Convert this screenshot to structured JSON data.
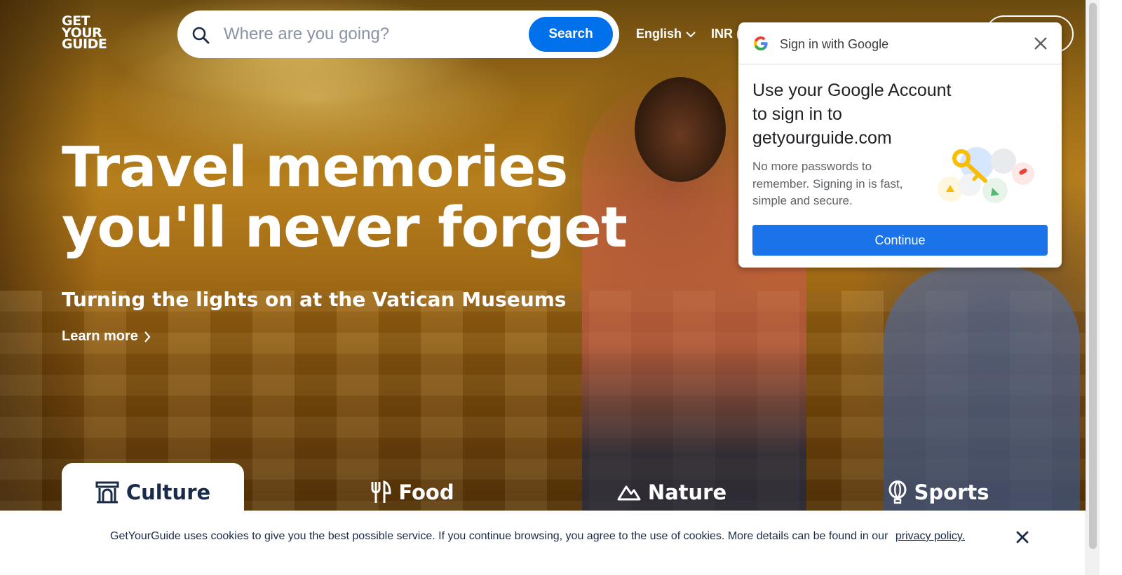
{
  "header": {
    "logo_lines": [
      "GET",
      "YOUR",
      "GUIDE"
    ],
    "search": {
      "placeholder": "Where are you going?",
      "value": "",
      "button_label": "Search"
    },
    "language": "English",
    "currency": "INR (₹)"
  },
  "hero": {
    "headline_lines": [
      "Travel memories",
      "you'll never forget"
    ],
    "subheadline": "Turning the lights on at the Vatican Museums",
    "learn_more": "Learn more"
  },
  "categories": [
    {
      "label": "Culture",
      "icon": "museum-icon",
      "active": true
    },
    {
      "label": "Food",
      "icon": "fork-knife-icon",
      "active": false
    },
    {
      "label": "Nature",
      "icon": "mountain-icon",
      "active": false
    },
    {
      "label": "Sports",
      "icon": "balloon-icon",
      "active": false
    }
  ],
  "cookie_banner": {
    "text": "GetYourGuide uses cookies to give you the best possible service. If you continue browsing, you agree to the use of cookies. More details can be found in our",
    "link": "privacy policy."
  },
  "google_signin": {
    "header": "Sign in with Google",
    "title": "Use your Google Account to sign in to getyourguide.com",
    "description": "No more passwords to remember. Signing in is fast, simple and secure.",
    "continue_label": "Continue"
  },
  "colors": {
    "brand_blue": "#0071eb",
    "google_blue": "#1a73e8",
    "text_dark": "#1a2b49"
  }
}
